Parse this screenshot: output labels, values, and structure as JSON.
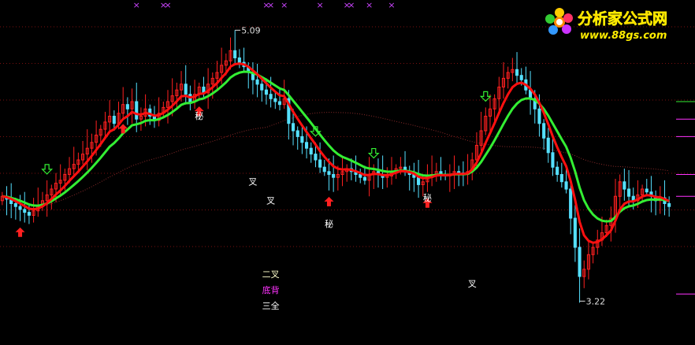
{
  "chart_data": {
    "type": "candlestick",
    "ylim": [
      3.0,
      5.2
    ],
    "n_bars": 150,
    "price_high_label": "5.09",
    "price_low_label": "3.22",
    "high_value": 5.09,
    "low_value": 3.22,
    "grid": "dotted horizontal",
    "colors": {
      "background": "#000000",
      "up_candle": "#ff2020",
      "down_candle": "#55e0ff",
      "ma_fast": "#ff1010",
      "ma_slow": "#33ee33",
      "ma_long": "#8a2a2a",
      "text_label": "#ffffff",
      "magenta_label": "#ff33ff",
      "cross_marker": "#cc44ff",
      "buy_arrow": "#ff2020",
      "sell_arrow": "#33ee33"
    },
    "close": [
      3.95,
      3.93,
      3.9,
      3.88,
      3.86,
      3.84,
      3.82,
      3.85,
      3.88,
      3.92,
      3.96,
      4.0,
      4.04,
      4.06,
      4.1,
      4.14,
      4.17,
      4.2,
      4.24,
      4.28,
      4.32,
      4.37,
      4.41,
      4.46,
      4.5,
      4.45,
      4.52,
      4.58,
      4.55,
      4.6,
      4.48,
      4.5,
      4.55,
      4.5,
      4.47,
      4.52,
      4.56,
      4.6,
      4.64,
      4.68,
      4.72,
      4.65,
      4.6,
      4.65,
      4.7,
      4.66,
      4.72,
      4.76,
      4.8,
      4.85,
      4.88,
      4.95,
      4.9,
      4.87,
      4.84,
      4.8,
      4.75,
      4.72,
      4.68,
      4.65,
      4.62,
      4.6,
      4.58,
      4.62,
      4.45,
      4.4,
      4.36,
      4.32,
      4.28,
      4.24,
      4.2,
      4.15,
      4.12,
      4.1,
      4.08,
      4.1,
      4.12,
      4.14,
      4.12,
      4.1,
      4.08,
      4.06,
      4.1,
      4.12,
      4.1,
      4.08,
      4.09,
      4.12,
      4.14,
      4.15,
      4.12,
      4.1,
      4.08,
      4.03,
      4.05,
      4.08,
      4.1,
      4.12,
      4.1,
      4.09,
      4.1,
      4.12,
      4.11,
      4.1,
      4.12,
      4.2,
      4.3,
      4.4,
      4.5,
      4.55,
      4.62,
      4.7,
      4.76,
      4.8,
      4.82,
      4.78,
      4.75,
      4.68,
      4.62,
      4.55,
      4.45,
      4.35,
      4.25,
      4.15,
      4.1,
      4.05,
      4.0,
      3.8,
      3.6,
      3.4,
      3.45,
      3.55,
      3.6,
      3.65,
      3.7,
      3.75,
      3.8,
      3.95,
      4.05,
      4.0,
      3.95,
      3.92,
      3.96,
      4.0,
      3.98,
      3.95,
      3.92,
      3.94,
      3.9,
      3.88
    ],
    "open": [
      3.92,
      3.95,
      3.93,
      3.9,
      3.88,
      3.86,
      3.84,
      3.82,
      3.85,
      3.88,
      3.92,
      3.96,
      4.0,
      4.04,
      4.06,
      4.1,
      4.14,
      4.17,
      4.2,
      4.24,
      4.28,
      4.32,
      4.37,
      4.41,
      4.46,
      4.5,
      4.45,
      4.52,
      4.58,
      4.55,
      4.6,
      4.48,
      4.5,
      4.55,
      4.5,
      4.47,
      4.52,
      4.56,
      4.6,
      4.64,
      4.68,
      4.72,
      4.65,
      4.6,
      4.65,
      4.7,
      4.66,
      4.72,
      4.76,
      4.8,
      4.85,
      4.88,
      4.95,
      4.9,
      4.87,
      4.84,
      4.8,
      4.75,
      4.72,
      4.68,
      4.65,
      4.62,
      4.6,
      4.58,
      4.62,
      4.45,
      4.4,
      4.36,
      4.32,
      4.28,
      4.24,
      4.2,
      4.15,
      4.12,
      4.1,
      4.08,
      4.1,
      4.12,
      4.14,
      4.12,
      4.1,
      4.08,
      4.06,
      4.1,
      4.12,
      4.1,
      4.08,
      4.09,
      4.12,
      4.14,
      4.15,
      4.12,
      4.1,
      4.08,
      4.03,
      4.05,
      4.08,
      4.1,
      4.12,
      4.1,
      4.09,
      4.1,
      4.12,
      4.11,
      4.1,
      4.12,
      4.2,
      4.3,
      4.4,
      4.5,
      4.55,
      4.62,
      4.7,
      4.76,
      4.8,
      4.82,
      4.78,
      4.75,
      4.68,
      4.62,
      4.55,
      4.45,
      4.35,
      4.25,
      4.15,
      4.1,
      4.05,
      4.0,
      3.8,
      3.6,
      3.4,
      3.45,
      3.55,
      3.6,
      3.65,
      3.7,
      3.75,
      3.8,
      3.95,
      4.05,
      4.0,
      3.95,
      3.92,
      3.96,
      4.0,
      3.98,
      3.95,
      3.92,
      3.94,
      3.9
    ],
    "signals": [
      {
        "text": "秘",
        "bar": 44,
        "price": 4.48,
        "color": "#ffffff"
      },
      {
        "text": "叉",
        "bar": 56,
        "price": 4.03,
        "color": "#ffffff"
      },
      {
        "text": "叉",
        "bar": 60,
        "price": 3.9,
        "color": "#ffffff"
      },
      {
        "text": "秘",
        "bar": 73,
        "price": 3.74,
        "color": "#ffffff"
      },
      {
        "text": "秘",
        "bar": 95,
        "price": 3.92,
        "color": "#ffffff"
      },
      {
        "text": "叉",
        "bar": 105,
        "price": 3.33,
        "color": "#ffffff"
      }
    ],
    "pattern_labels": [
      {
        "text": "二叉",
        "color": "#ffffcc"
      },
      {
        "text": "底背",
        "color": "#ff33ff"
      },
      {
        "text": "三全",
        "color": "#ffffff"
      }
    ],
    "buy_arrows": [
      4,
      27,
      44,
      73,
      95
    ],
    "sell_arrows": [
      10,
      70,
      83,
      108
    ],
    "cross_markers": [
      30,
      36,
      37,
      59,
      60,
      63,
      71,
      77,
      78,
      82,
      87
    ],
    "right_ticks": [
      {
        "price": 4.6,
        "color": "#33ee33"
      },
      {
        "price": 4.48,
        "color": "#ff33ff"
      },
      {
        "price": 4.36,
        "color": "#ff33ff"
      },
      {
        "price": 4.1,
        "color": "#ff33ff"
      },
      {
        "price": 3.95,
        "color": "#ff33ff"
      },
      {
        "price": 3.28,
        "color": "#ff33ff"
      }
    ]
  },
  "logo": {
    "title": "分析家公式网",
    "url": "www.88gs.com"
  }
}
